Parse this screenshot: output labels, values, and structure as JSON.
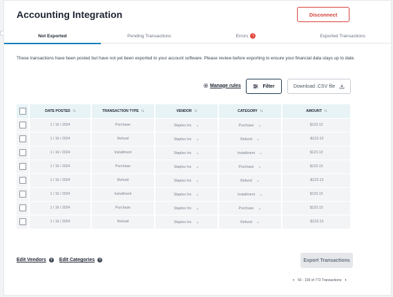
{
  "header": {
    "title": "Accounting Integration",
    "disconnect_label": "Disconnect"
  },
  "tabs": [
    {
      "label": "Not Exported",
      "active": true
    },
    {
      "label": "Pending Transactions",
      "active": false
    },
    {
      "label": "Errors",
      "active": false,
      "badge": "!"
    },
    {
      "label": "Exported Transactions",
      "active": false
    }
  ],
  "description": "These transactions have been posted but have not yet been exported to your account software. Please review before exporting to ensure your financial data stays up to date.",
  "toolbar": {
    "manage_rules": "Manage rules",
    "filter": "Filter",
    "download_csv": "Download .CSV file"
  },
  "table": {
    "columns": [
      "DATE POSTED",
      "TRANSACTION TYPE",
      "VENDOR",
      "CATEGORY",
      "AMOUNT"
    ],
    "rows": [
      {
        "date": "1 / 16 / 2024",
        "type": "Purchase",
        "vendor": "Staples Inc",
        "category": "Purchase",
        "amount": "$123.13"
      },
      {
        "date": "1 / 16 / 2024",
        "type": "Refund",
        "vendor": "Staples Inc",
        "category": "Refund",
        "amount": "-$123.13"
      },
      {
        "date": "1 / 16 / 2024",
        "type": "Installment",
        "vendor": "Staples Inc",
        "category": "Installment",
        "amount": "$123.13"
      },
      {
        "date": "1 / 16 / 2024",
        "type": "Purchase",
        "vendor": "Staples Inc",
        "category": "Purchase",
        "amount": "$123.13"
      },
      {
        "date": "1 / 16 / 2024",
        "type": "Refund",
        "vendor": "Staples Inc",
        "category": "Refund",
        "amount": "-$123.13"
      },
      {
        "date": "1 / 16 / 2024",
        "type": "Installment",
        "vendor": "Staples Inc",
        "category": "Installment",
        "amount": "$123.13"
      },
      {
        "date": "1 / 16 / 2024",
        "type": "Purchase",
        "vendor": "Staples Inc",
        "category": "Purchase",
        "amount": "$123.13"
      },
      {
        "date": "1 / 16 / 2024",
        "type": "Refund",
        "vendor": "Staples Inc",
        "category": "Refund",
        "amount": "-$123.13"
      }
    ]
  },
  "footer": {
    "edit_vendors": "Edit Vendors",
    "edit_categories": "Edit Categories",
    "export_button": "Export Transactions",
    "pagination": "50 - 100 of 772 Transactions"
  },
  "colors": {
    "accent": "#0e7cb8",
    "danger": "#d6403b",
    "header_bg": "#e8f3f6"
  }
}
